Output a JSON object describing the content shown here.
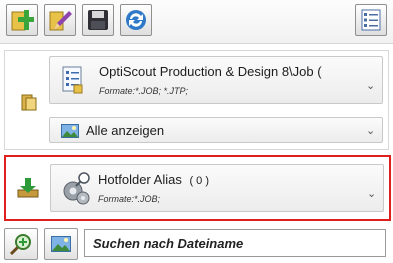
{
  "source": {
    "path_label": "OptiScout Production & Design 8\\Job (",
    "formats_label": "Formate:*.JOB; *.JTP;"
  },
  "filter": {
    "selected": "Alle anzeigen"
  },
  "hotfolder": {
    "name": "Hotfolder Alias",
    "count": "( 0 )",
    "formats_label": "Formate:*.JOB;"
  },
  "search": {
    "placeholder": "Suchen nach Dateiname"
  },
  "colors": {
    "highlight_border": "#e01e1e"
  }
}
